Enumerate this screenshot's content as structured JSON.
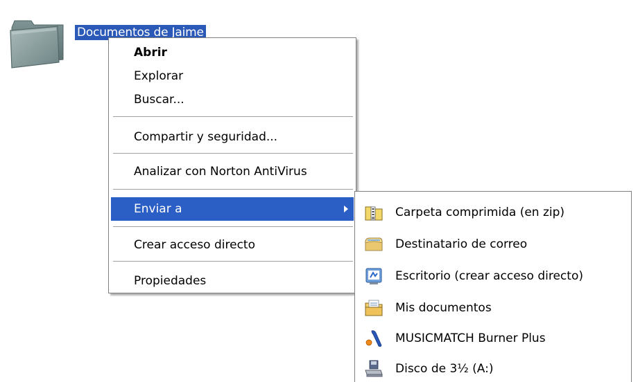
{
  "desktop": {
    "folder_label": "Documentos de Jaime",
    "folder_icon": "folder-icon"
  },
  "context_menu": {
    "items": [
      {
        "label": "Abrir",
        "bold": true
      },
      {
        "label": "Explorar"
      },
      {
        "label": "Buscar..."
      },
      {
        "label": "Compartir y seguridad..."
      },
      {
        "label": "Analizar con Norton AntiVirus"
      },
      {
        "label": "Enviar a",
        "highlighted": true,
        "has_submenu": true
      },
      {
        "label": "Crear acceso directo"
      },
      {
        "label": "Propiedades"
      }
    ]
  },
  "send_to_submenu": {
    "items": [
      {
        "label": "Carpeta comprimida (en zip)",
        "icon": "zip-folder-icon"
      },
      {
        "label": "Destinatario de correo",
        "icon": "mail-recipient-icon"
      },
      {
        "label": "Escritorio (crear acceso directo)",
        "icon": "desktop-shortcut-icon"
      },
      {
        "label": "Mis documentos",
        "icon": "my-documents-icon"
      },
      {
        "label": "MUSICMATCH Burner Plus",
        "icon": "musicmatch-icon"
      },
      {
        "label": "Disco de 3½ (A:)",
        "icon": "floppy-drive-icon"
      }
    ]
  },
  "colors": {
    "selection": "#2c5fc5",
    "menu_border": "#7f7f7f",
    "folder_face": "#8ea3a3"
  }
}
